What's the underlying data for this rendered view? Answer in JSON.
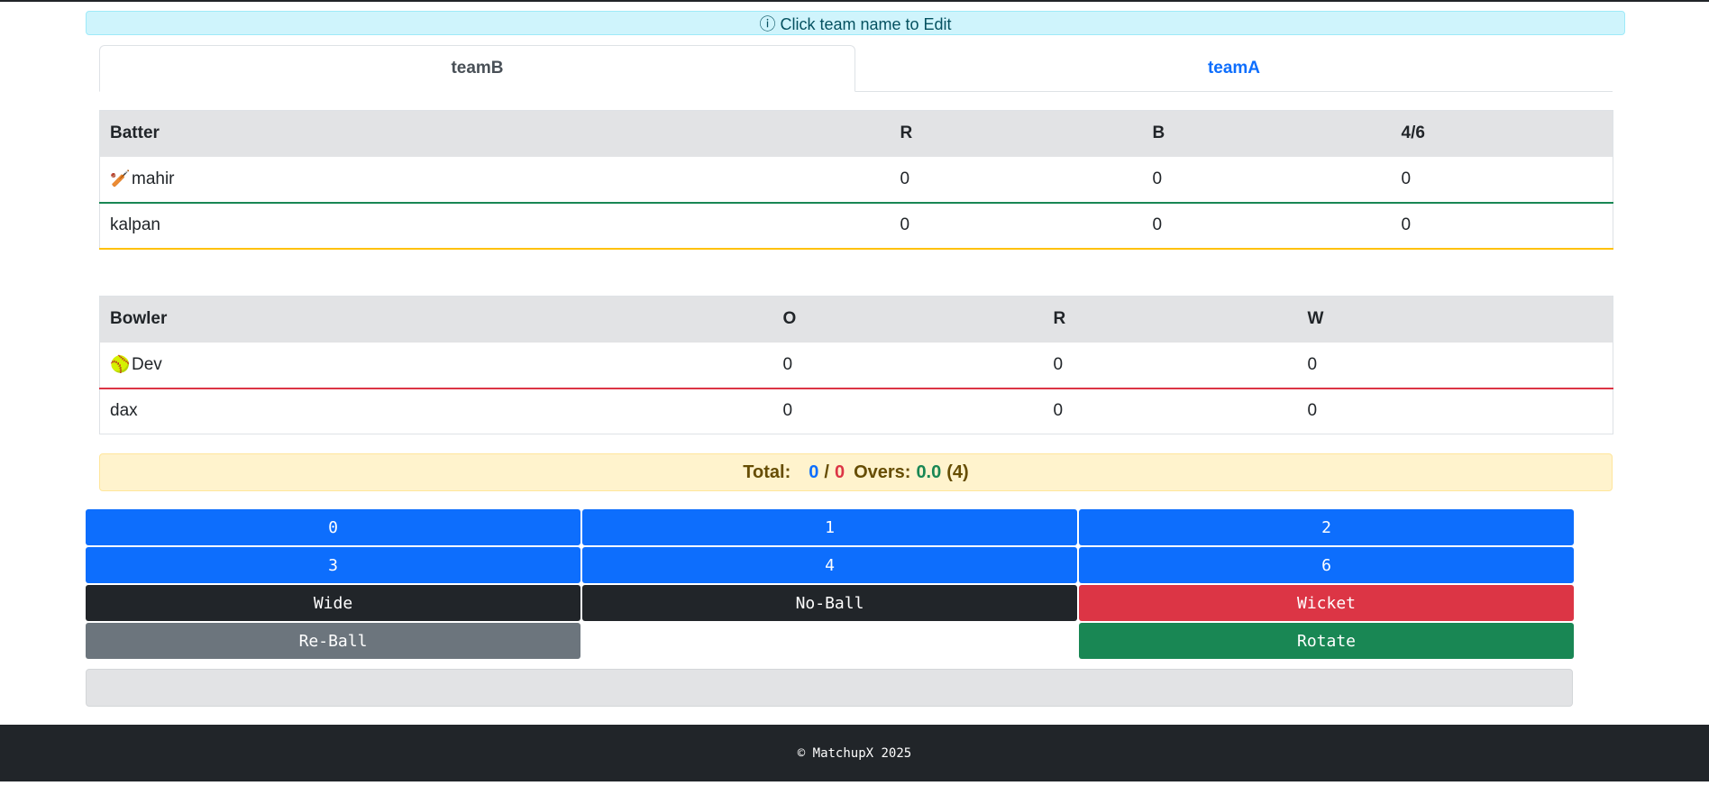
{
  "info_banner": {
    "icon": "info-circle-icon",
    "text": "ⓘ Click team name to Edit"
  },
  "tabs": [
    {
      "label": "teamB",
      "active": true
    },
    {
      "label": "teamA",
      "active": false
    }
  ],
  "batting": {
    "headers": [
      "Batter",
      "R",
      "B",
      "4/6"
    ],
    "rows": [
      {
        "icon": "🏏",
        "name": "mahir",
        "r": "0",
        "b": "0",
        "fs": "0",
        "status": "striker"
      },
      {
        "icon": "",
        "name": "kalpan",
        "r": "0",
        "b": "0",
        "fs": "0",
        "status": "non-striker"
      }
    ]
  },
  "bowling": {
    "headers": [
      "Bowler",
      "O",
      "R",
      "W"
    ],
    "rows": [
      {
        "icon": "🥎",
        "name": "Dev",
        "o": "0",
        "r": "0",
        "w": "0",
        "status": "current"
      },
      {
        "icon": "",
        "name": "dax",
        "o": "0",
        "r": "0",
        "w": "0",
        "status": "other"
      }
    ]
  },
  "total": {
    "label": "Total:",
    "runs": "0",
    "separator": "/",
    "wickets": "0",
    "overs_label": "Overs:",
    "overs": "0.0",
    "overs_limit": "(4)"
  },
  "buttons": {
    "run0": "0",
    "run1": "1",
    "run2": "2",
    "run3": "3",
    "run4": "4",
    "run6": "6",
    "wide": "Wide",
    "noball": "No-Ball",
    "wicket": "Wicket",
    "reball": "Re-Ball",
    "rotate": "Rotate"
  },
  "footer": {
    "text": "© MatchupX 2025"
  },
  "colors": {
    "primary": "#0d6efd",
    "dark": "#212529",
    "danger": "#dc3545",
    "secondary": "#6c757d",
    "success": "#198754",
    "warning": "#ffc107"
  }
}
